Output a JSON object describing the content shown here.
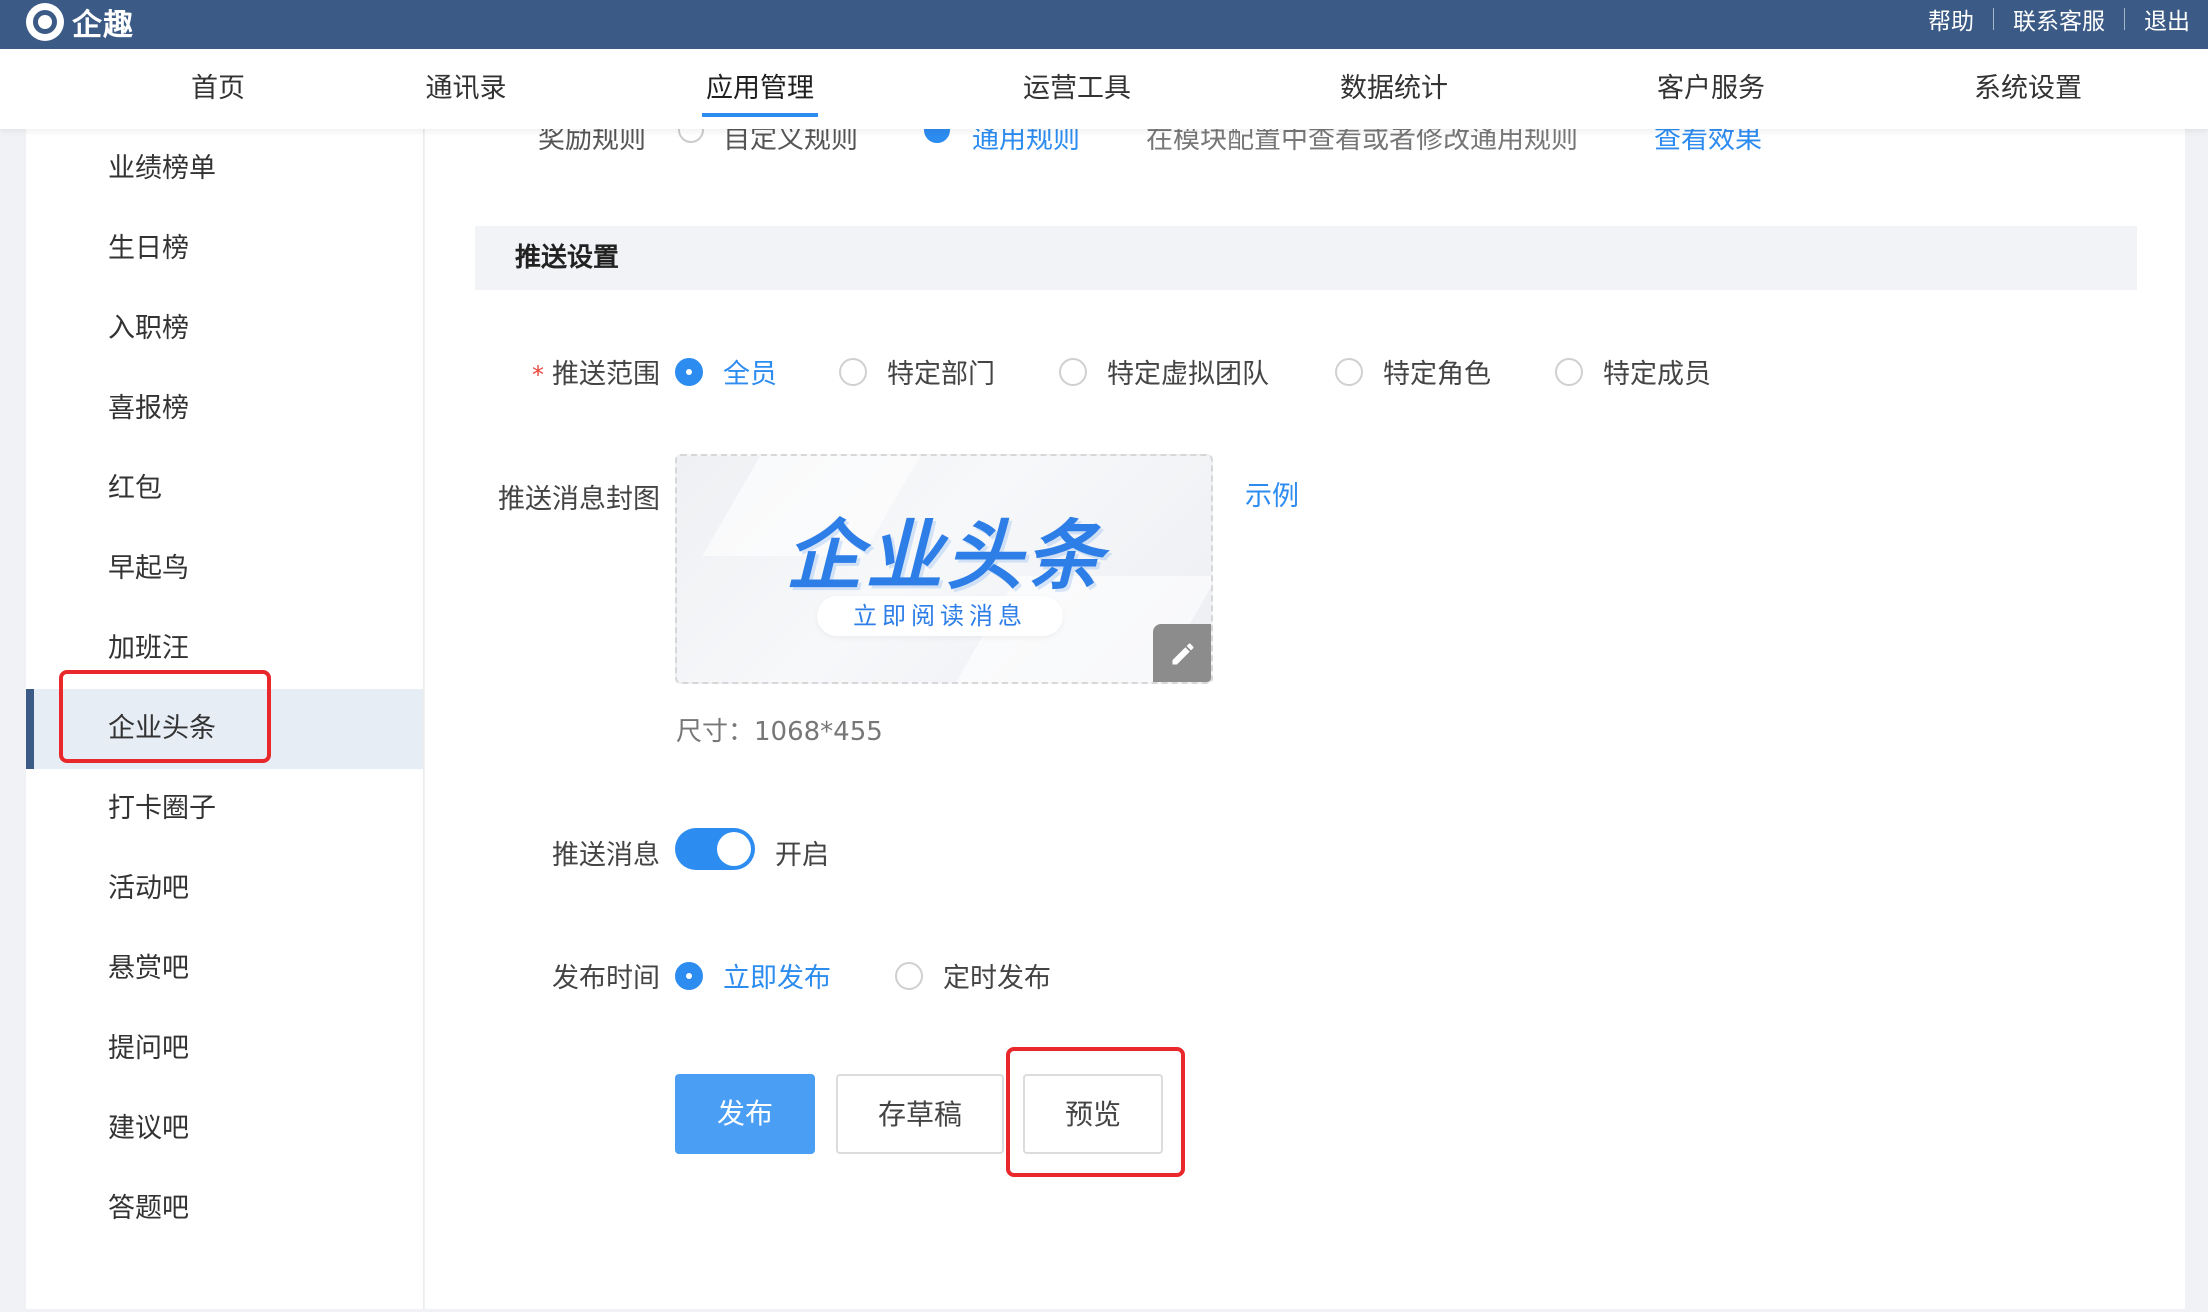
{
  "topbar": {
    "brand": "企趣",
    "links": [
      "帮助",
      "联系客服",
      "退出"
    ]
  },
  "nav": {
    "items": [
      "首页",
      "通讯录",
      "应用管理",
      "运营工具",
      "数据统计",
      "客户服务",
      "系统设置"
    ],
    "active": "应用管理"
  },
  "sidebar": {
    "items": [
      "业绩榜单",
      "生日榜",
      "入职榜",
      "喜报榜",
      "红包",
      "早起鸟",
      "加班汪",
      "企业头条",
      "打卡圈子",
      "活动吧",
      "悬赏吧",
      "提问吧",
      "建议吧",
      "答题吧"
    ],
    "active": "企业头条"
  },
  "reward_row": {
    "label": "奖励规则",
    "option_custom": "自定义规则",
    "option_general": "通用规则",
    "hint": "在模块配置中查看或者修改通用规则",
    "link": "查看效果"
  },
  "section": {
    "title": "推送设置"
  },
  "push_scope": {
    "required_mark": "*",
    "label": "推送范围",
    "options": [
      "全员",
      "特定部门",
      "特定虚拟团队",
      "特定角色",
      "特定成员"
    ],
    "selected": "全员"
  },
  "cover": {
    "label": "推送消息封图",
    "image_title": "企业头条",
    "image_subtitle": "立即阅读消息",
    "example_link": "示例",
    "size_text": "尺寸：1068*455"
  },
  "push_message": {
    "label": "推送消息",
    "enabled": true,
    "state_text": "开启"
  },
  "publish_time": {
    "label": "发布时间",
    "options": [
      "立即发布",
      "定时发布"
    ],
    "selected": "立即发布"
  },
  "actions": {
    "publish": "发布",
    "save_draft": "存草稿",
    "preview": "预览"
  },
  "colors": {
    "topbar": "#3b5b86",
    "accent": "#2d8cf0",
    "highlight": "#e8282b"
  }
}
